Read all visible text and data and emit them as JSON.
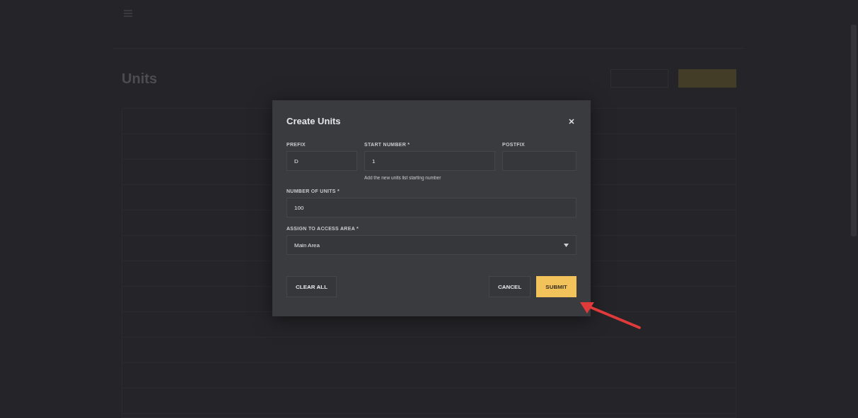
{
  "page": {
    "title": "Units"
  },
  "dialog": {
    "title": "Create Units",
    "rows": [
      [
        {
          "kind": "text",
          "label": "PREFIX",
          "value": "D"
        },
        {
          "kind": "text",
          "label": "START NUMBER *",
          "value": "1",
          "helper": "Add the new units list starting number"
        },
        {
          "kind": "text",
          "label": "POSTFIX"
        }
      ],
      [
        {
          "kind": "text",
          "label": "NUMBER OF UNITS *",
          "value": "100"
        }
      ],
      [
        {
          "kind": "select",
          "label": "ASSIGN TO ACCESS AREA *",
          "value": "Main Area"
        }
      ]
    ],
    "buttons": [
      {
        "label": "CLEAR ALL",
        "kind": "plain"
      },
      {
        "label": "CANCEL",
        "kind": "plain"
      },
      {
        "label": "SUBMIT",
        "kind": "primary"
      }
    ]
  }
}
